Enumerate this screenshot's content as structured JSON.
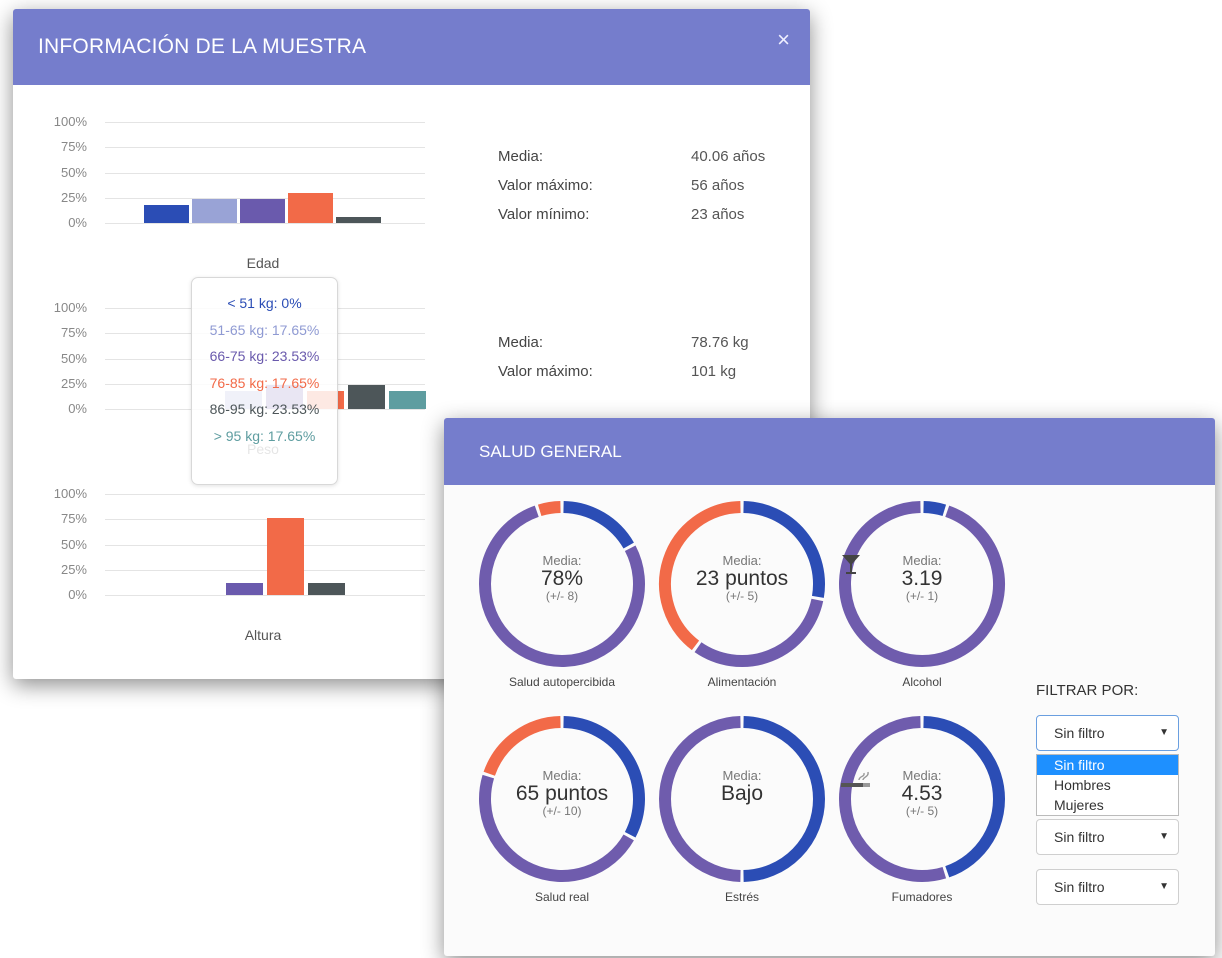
{
  "colors": {
    "header": "#757dcc",
    "blue": "#2b4db5",
    "lightblue": "#99a3d6",
    "purple": "#6a5aad",
    "orange": "#f26a48",
    "darkgray": "#4d5659",
    "teal": "#5e9da0",
    "ring_purple": "#6f5cad"
  },
  "sample_panel": {
    "title": "INFORMACIÓN DE LA MUESTRA",
    "close_icon": "close-icon",
    "close_label": "×",
    "age_stats": [
      {
        "label": "Media:",
        "value": "40.06 años"
      },
      {
        "label": "Valor máximo:",
        "value": "56 años"
      },
      {
        "label": "Valor mínimo:",
        "value": "23 años"
      }
    ],
    "weight_stats": [
      {
        "label": "Media:",
        "value": "78.76 kg"
      },
      {
        "label": "Valor máximo:",
        "value": "101 kg"
      }
    ],
    "tooltip": [
      {
        "text": "< 51 kg: 0%",
        "color": "#2b4db5"
      },
      {
        "text": "51-65 kg: 17.65%",
        "color": "#8f9ad3"
      },
      {
        "text": "66-75 kg: 23.53%",
        "color": "#6a5aad"
      },
      {
        "text": "76-85 kg: 17.65%",
        "color": "#f26a48"
      },
      {
        "text": "86-95 kg: 23.53%",
        "color": "#4d5659"
      },
      {
        "text": "> 95 kg: 17.65%",
        "color": "#5e9da0"
      }
    ]
  },
  "chart_data": [
    {
      "type": "bar",
      "xlabel": "Edad",
      "ylim": [
        0,
        100
      ],
      "yticks": [
        "100%",
        "75%",
        "50%",
        "25%",
        "0%"
      ],
      "values": [
        18,
        24,
        24,
        30,
        6
      ],
      "colors": [
        "#2b4db5",
        "#99a3d6",
        "#6a5aad",
        "#f26a48",
        "#4d5659"
      ]
    },
    {
      "type": "bar",
      "xlabel": "Peso",
      "ylim": [
        0,
        100
      ],
      "yticks": [
        "100%",
        "75%",
        "50%",
        "25%",
        "0%"
      ],
      "values": [
        0,
        17.65,
        23.53,
        17.65,
        23.53,
        17.65
      ],
      "colors": [
        "#2b4db5",
        "#99a3d6",
        "#6a5aad",
        "#f26a48",
        "#4d5659",
        "#5e9da0"
      ]
    },
    {
      "type": "bar",
      "xlabel": "Altura",
      "ylim": [
        0,
        100
      ],
      "yticks": [
        "100%",
        "75%",
        "50%",
        "25%",
        "0%"
      ],
      "values": [
        12,
        76,
        12
      ],
      "colors": [
        "#6a5aad",
        "#f26a48",
        "#4d5659"
      ]
    }
  ],
  "health_panel": {
    "title": "SALUD GENERAL",
    "donuts": [
      {
        "label": "Salud autopercibida",
        "media": "Media:",
        "value": "78%",
        "pm": "(+/- 8)",
        "icon": "",
        "segments": [
          {
            "frac": 0.17,
            "color": "#2b4db5"
          },
          {
            "frac": 0.78,
            "color": "#6f5cad"
          },
          {
            "frac": 0.05,
            "color": "#f26a48"
          }
        ]
      },
      {
        "label": "Alimentación",
        "media": "Media:",
        "value": "23 puntos",
        "pm": "(+/- 5)",
        "icon": "",
        "segments": [
          {
            "frac": 0.28,
            "color": "#2b4db5"
          },
          {
            "frac": 0.32,
            "color": "#6f5cad"
          },
          {
            "frac": 0.4,
            "color": "#f26a48"
          }
        ]
      },
      {
        "label": "Alcohol",
        "media": "Media:",
        "value": "3.19",
        "pm": "(+/- 1)",
        "icon": "cocktail-icon",
        "segments": [
          {
            "frac": 0.05,
            "color": "#2b4db5"
          },
          {
            "frac": 0.95,
            "color": "#6f5cad"
          }
        ]
      },
      {
        "label": "Salud real",
        "media": "Media:",
        "value": "65 puntos",
        "pm": "(+/- 10)",
        "icon": "",
        "segments": [
          {
            "frac": 0.33,
            "color": "#2b4db5"
          },
          {
            "frac": 0.47,
            "color": "#6f5cad"
          },
          {
            "frac": 0.2,
            "color": "#f26a48"
          }
        ]
      },
      {
        "label": "Estrés",
        "media": "Media:",
        "value": "Bajo",
        "pm": "",
        "icon": "",
        "segments": [
          {
            "frac": 0.5,
            "color": "#2b4db5"
          },
          {
            "frac": 0.5,
            "color": "#6f5cad"
          }
        ]
      },
      {
        "label": "Fumadores",
        "media": "Media:",
        "value": "4.53",
        "pm": "(+/- 5)",
        "icon": "cigarette-icon",
        "segments": [
          {
            "frac": 0.45,
            "color": "#2b4db5"
          },
          {
            "frac": 0.55,
            "color": "#6f5cad"
          }
        ]
      }
    ],
    "filter_title": "FILTRAR POR:",
    "selects": [
      "Sin filtro",
      "Sin filtro",
      "Sin filtro"
    ],
    "dropdown_options": [
      "Sin filtro",
      "Hombres",
      "Mujeres"
    ],
    "caret": "▼"
  }
}
